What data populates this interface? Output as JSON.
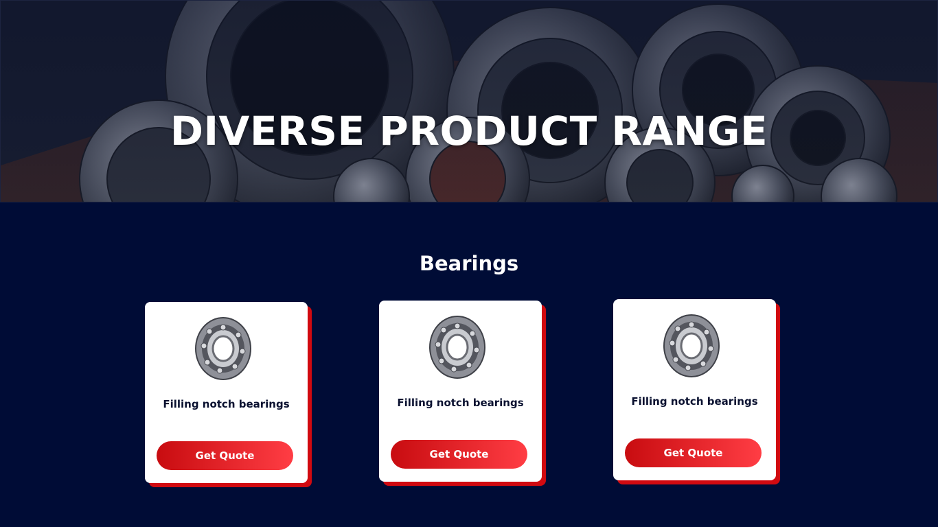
{
  "hero": {
    "title": "DIVERSE PRODUCT RANGE"
  },
  "section": {
    "title": "Bearings"
  },
  "products": [
    {
      "name": "Filling notch bearings",
      "button_label": "Get Quote"
    },
    {
      "name": "Filling notch bearings",
      "button_label": "Get Quote"
    },
    {
      "name": "Filling notch bearings",
      "button_label": "Get Quote"
    }
  ],
  "colors": {
    "page_background": "#000c36",
    "accent_red": "#d10a10",
    "button_gradient_start": "#c80c10",
    "button_gradient_end": "#ff3d44",
    "card_background": "#ffffff",
    "card_text": "#0a1130"
  }
}
